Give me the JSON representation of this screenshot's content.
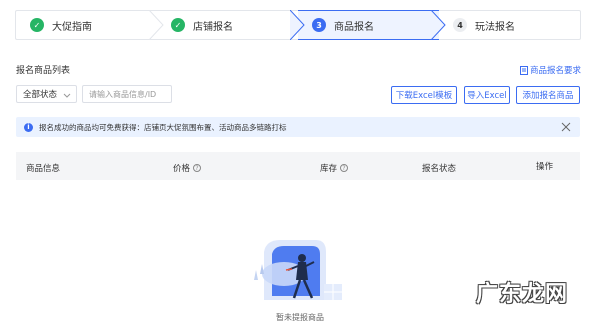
{
  "steps": [
    {
      "label": "大促指南",
      "state": "done"
    },
    {
      "label": "店铺报名",
      "state": "done"
    },
    {
      "label": "商品报名",
      "state": "current",
      "num": "3"
    },
    {
      "label": "玩法报名",
      "state": "todo",
      "num": "4"
    }
  ],
  "section": {
    "title": "报名商品列表",
    "requirement_link": "商品报名要求"
  },
  "filters": {
    "status_value": "全部状态",
    "search_placeholder": "请输入商品信息/ID"
  },
  "buttons": {
    "download_template": "下载Excel模板",
    "import_excel": "导入Excel",
    "add_product": "添加报名商品"
  },
  "notice": {
    "text": "报名成功的商品均可免费获得：店铺页大促氛围布置、活动商品多链路打标"
  },
  "table": {
    "columns": [
      "商品信息",
      "价格",
      "库存",
      "报名状态",
      "操作"
    ]
  },
  "empty": {
    "text": "暂未提报商品"
  },
  "watermark": "广东龙网",
  "colors": {
    "accent": "#3b6cf2",
    "success": "#26b565",
    "notice_bg": "#eaf2ff"
  }
}
